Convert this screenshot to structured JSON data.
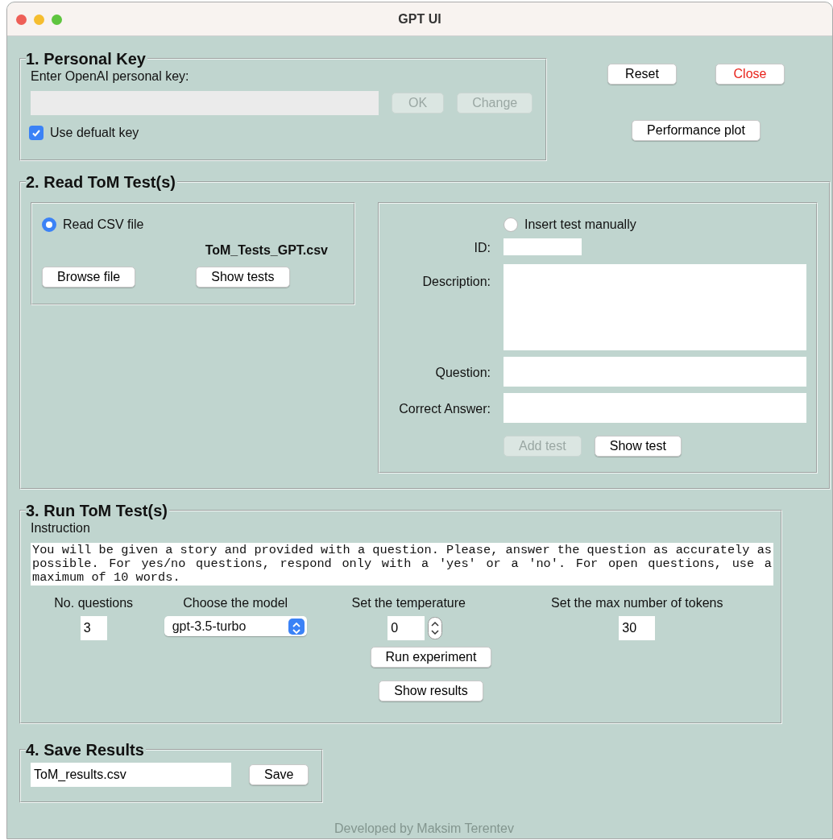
{
  "window": {
    "title": "GPT UI"
  },
  "personal_key": {
    "legend": "1. Personal Key",
    "label": "Enter OpenAI personal key:",
    "key_field": {
      "disabled": true
    },
    "buttons": [
      {
        "label": "OK",
        "disabled": true
      },
      {
        "label": "Change",
        "disabled": true
      }
    ],
    "checkbox": {
      "label": "Use defualt key",
      "checked": true
    }
  },
  "top_buttons": [
    {
      "label": "Reset",
      "kind": "normal"
    },
    {
      "label": "Close",
      "kind": "danger"
    },
    {
      "label": "Performance plot",
      "kind": "normal"
    }
  ],
  "read_tests": {
    "legend": "2. Read ToM Test(s)",
    "csv": {
      "radio": {
        "label": "Read CSV file",
        "selected": true
      },
      "filename": "ToM_Tests_GPT.csv",
      "buttons": [
        {
          "label": "Browse file"
        },
        {
          "label": "Show tests"
        }
      ]
    },
    "manual": {
      "radio": {
        "label": "Insert test manually",
        "selected": false
      },
      "fields": [
        {
          "label": "ID:",
          "kind": "short"
        },
        {
          "label": "Description:",
          "kind": "area"
        },
        {
          "label": "Question:",
          "kind": "line"
        },
        {
          "label": "Correct Answer:",
          "kind": "line"
        }
      ],
      "buttons": [
        {
          "label": "Add test",
          "disabled": true
        },
        {
          "label": "Show test",
          "disabled": false
        }
      ]
    }
  },
  "run_tests": {
    "legend": "3. Run ToM Test(s)",
    "instruction_label": "Instruction",
    "instruction": "You will be given a story and provided with a question. Please, answer the question as accurately as possible. For yes/no questions, respond only with a 'yes' or a 'no'. For open questions, use a maximum of 10 words.",
    "settings": [
      {
        "label": "No. questions",
        "kind": "number",
        "value": "3"
      },
      {
        "label": "Choose the model",
        "kind": "select",
        "value": "gpt-3.5-turbo"
      },
      {
        "label": "Set the temperature",
        "kind": "spinner",
        "value": "0"
      },
      {
        "label": "Set the max number of tokens",
        "kind": "number",
        "value": "30"
      }
    ],
    "buttons": [
      {
        "label": "Run experiment"
      },
      {
        "label": "Show results"
      }
    ]
  },
  "save": {
    "legend": "4. Save Results",
    "filename": "ToM_results.csv",
    "button": "Save"
  },
  "footer": "Developed by Maksim Terentev"
}
